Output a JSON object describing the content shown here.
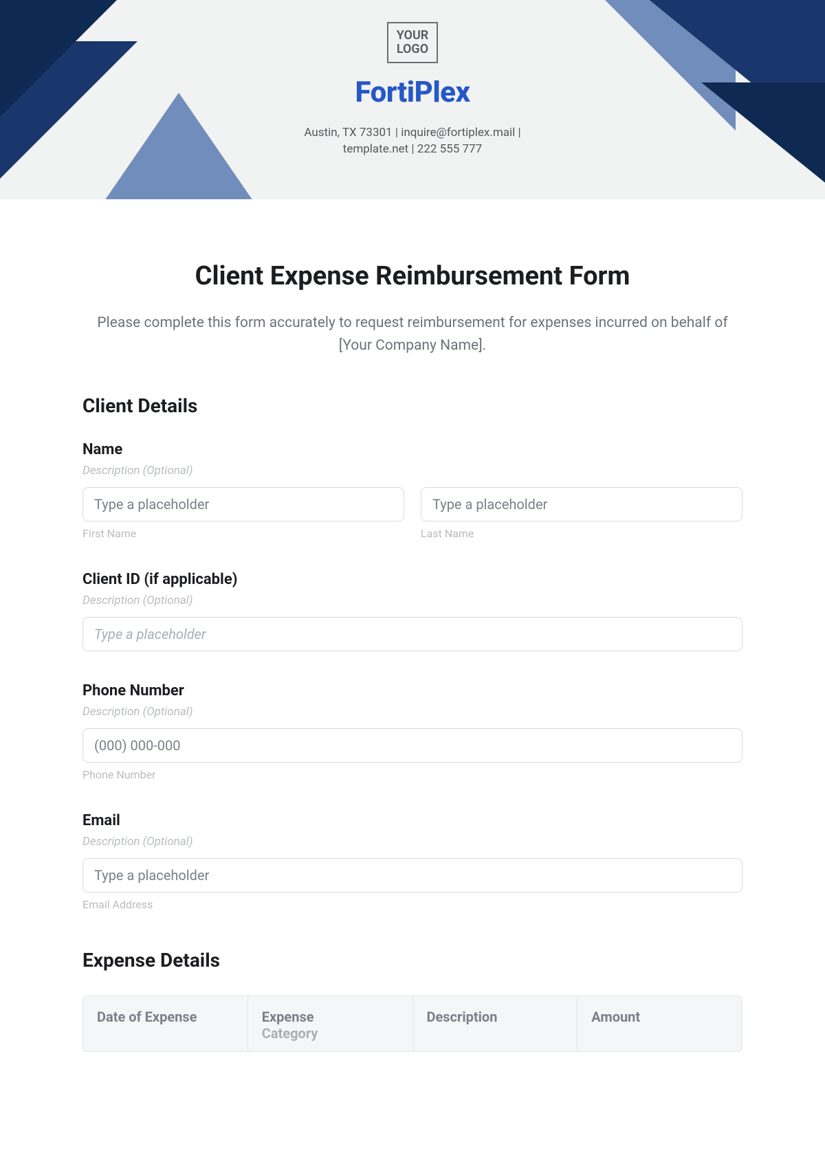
{
  "header": {
    "logo_line1": "YOUR",
    "logo_line2": "LOGO",
    "brand": "FortiPlex",
    "contact_line1": "Austin, TX 73301 | inquire@fortiplex.mail |",
    "contact_line2": "template.net | 222 555 777"
  },
  "form": {
    "title": "Client Expense Reimbursement Form",
    "intro": "Please complete this form accurately to request reimbursement for expenses incurred on behalf of [Your Company Name]."
  },
  "client_details": {
    "heading": "Client Details",
    "name": {
      "label": "Name",
      "desc": "Description (Optional)",
      "first_placeholder": "Type a placeholder",
      "first_sublabel": "First Name",
      "last_placeholder": "Type a placeholder",
      "last_sublabel": "Last Name"
    },
    "client_id": {
      "label": "Client ID (if applicable)",
      "desc": "Description (Optional)",
      "placeholder": "Type a placeholder"
    },
    "phone": {
      "label": "Phone Number",
      "desc": "Description (Optional)",
      "placeholder": "(000) 000-000",
      "sublabel": "Phone Number"
    },
    "email": {
      "label": "Email",
      "desc": "Description (Optional)",
      "placeholder": "Type a placeholder",
      "sublabel": "Email Address"
    }
  },
  "expense_details": {
    "heading": "Expense Details",
    "columns": {
      "date": "Date of Expense",
      "category_line1": "Expense",
      "category_line2": "Category",
      "description": "Description",
      "amount": "Amount"
    }
  }
}
